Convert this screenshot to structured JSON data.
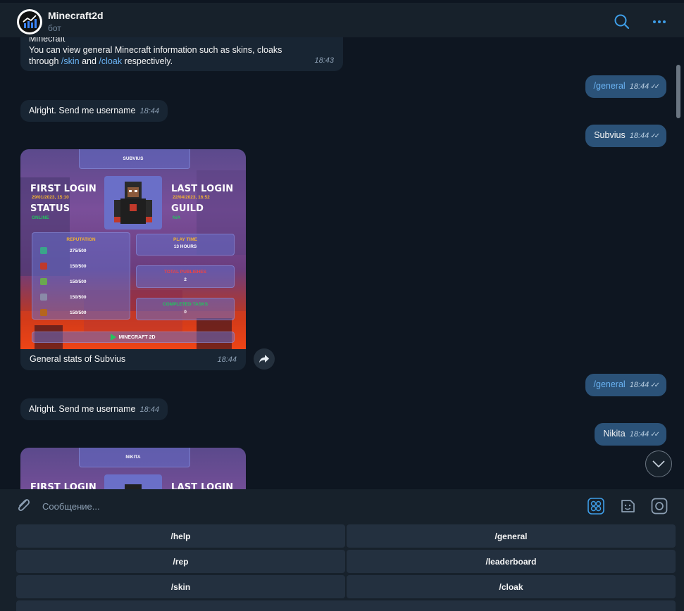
{
  "header": {
    "title": "Minecraft2d",
    "subtitle": "бот"
  },
  "messages": {
    "m1": {
      "line1": "Minecraft",
      "line2": "You can view general Minecraft information such as skins, cloaks",
      "through": "through",
      "skin": "/skin",
      "and": "and",
      "cloak": "/cloak",
      "respectively": "respectively.",
      "time": "18:43"
    },
    "m2": {
      "text": "/general",
      "time": "18:44"
    },
    "m3": {
      "text": "Alright. Send me username",
      "time": "18:44"
    },
    "m4": {
      "text": "Subvius",
      "time": "18:44"
    },
    "m5": {
      "caption": "General stats of Subvius",
      "time": "18:44"
    },
    "m6": {
      "text": "/general",
      "time": "18:44"
    },
    "m7": {
      "text": "Alright. Send me username",
      "time": "18:44"
    },
    "m8": {
      "text": "Nikita",
      "time": "18:44"
    }
  },
  "card1": {
    "username": "SUBVIUS",
    "first_login_label": "FIRST LOGIN",
    "first_login_value": "29/01/2023, 15:10",
    "last_login_label": "LAST LOGIN",
    "last_login_value": "22/04/2023, 16:52",
    "status_label": "STATUS",
    "status_value": "ONLINE",
    "guild_label": "GUILD",
    "guild_value": "N/A",
    "reputation_label": "REPUTATION",
    "rep_values": [
      "275/500",
      "150/500",
      "150/500",
      "150/500",
      "150/500"
    ],
    "play_time_label": "PLAY TIME",
    "play_time_value": "13 HOURS",
    "publishes_label": "TOTAL PUBLISHES",
    "publishes_value": "2",
    "tasks_label": "COMPLETED TASKS",
    "tasks_value": "0",
    "brand": "MINECRAFT 2D"
  },
  "card2": {
    "username": "NIKITA",
    "first_login_label": "FIRST LOGIN",
    "last_login_label": "LAST LOGIN"
  },
  "composer": {
    "placeholder": "Сообщение..."
  },
  "keyboard": {
    "help": "/help",
    "general": "/general",
    "rep": "/rep",
    "leaderboard": "/leaderboard",
    "skin": "/skin",
    "cloak": "/cloak"
  },
  "icons": {
    "avatar": "chart-logo-icon",
    "search": "search-icon",
    "more": "more-icon",
    "attach": "paperclip-icon",
    "bot_keyboard": "keyboard-grid-icon",
    "sticker": "sticker-icon",
    "camera": "camera-icon",
    "share": "share-icon",
    "scroll_down": "chevron-down-icon"
  },
  "colors": {
    "accent": "#2b5278",
    "link": "#6ab3f3",
    "background": "#0e1621",
    "panel": "#17212b"
  }
}
